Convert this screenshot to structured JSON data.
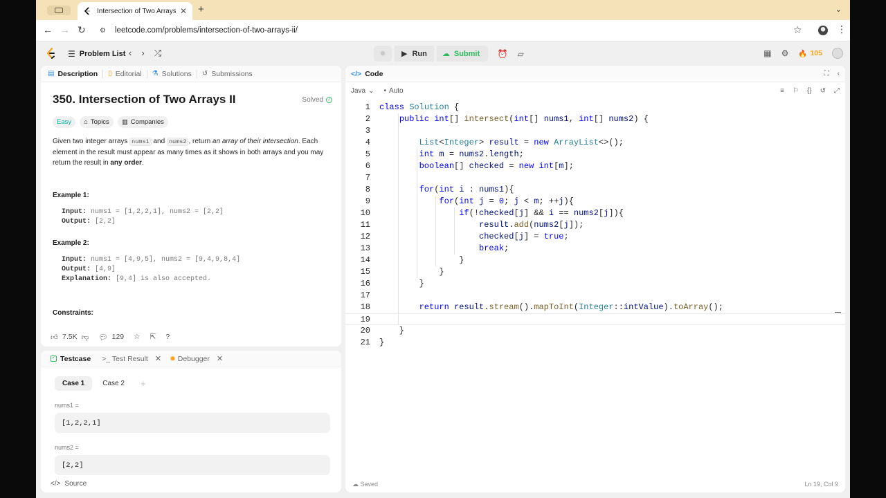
{
  "browser": {
    "tab_title": "Intersection of Two Arrays II",
    "url": "leetcode.com/problems/intersection-of-two-arrays-ii/"
  },
  "nav": {
    "problem_list": "Problem List",
    "run": "Run",
    "submit": "Submit",
    "streak": "105"
  },
  "description": {
    "tabs": [
      "Description",
      "Editorial",
      "Solutions",
      "Submissions"
    ],
    "title": "350. Intersection of Two Arrays II",
    "status": "Solved",
    "difficulty": "Easy",
    "topics": "Topics",
    "companies": "Companies",
    "text": {
      "p1": "Given two integer arrays ",
      "c1": "nums1",
      "p2": " and ",
      "c2": "nums2",
      "p3": ", return ",
      "em": "an array of their intersection",
      "p4": ". Each element in the result must appear as many times as it shows in both arrays and you may return the result in ",
      "strong": "any order",
      "p5": "."
    },
    "example1": {
      "title": "Example 1:",
      "input_label": "Input:",
      "input": "nums1 = [1,2,2,1], nums2 = [2,2]",
      "output_label": "Output:",
      "output": "[2,2]"
    },
    "example2": {
      "title": "Example 2:",
      "input_label": "Input:",
      "input": "nums1 = [4,9,5], nums2 = [9,4,9,8,4]",
      "output_label": "Output:",
      "output": "[4,9]",
      "explanation_label": "Explanation:",
      "explanation": "[9,4] is also accepted."
    },
    "constraints": "Constraints:",
    "likes": "7.5K",
    "comments": "129"
  },
  "code": {
    "title": "Code",
    "language": "Java",
    "mode": "Auto",
    "saved": "Saved",
    "position": "Ln 19, Col 9"
  },
  "testcase": {
    "tabs": [
      "Testcase",
      "Test Result",
      "Debugger"
    ],
    "cases": [
      "Case 1",
      "Case 2"
    ],
    "var1_label": "nums1 =",
    "var1_value": "[1,2,2,1]",
    "var2_label": "nums2 =",
    "var2_value": "[2,2]",
    "source": "Source"
  },
  "colors": {
    "brand_orange": "#ffa116",
    "accepted_green": "#2cbb5d",
    "easy_teal": "#00b8a3"
  }
}
